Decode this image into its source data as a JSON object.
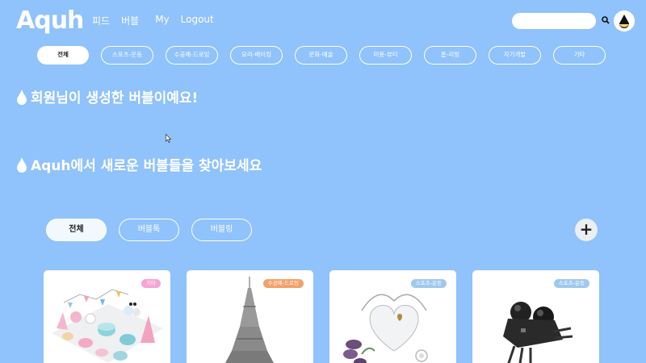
{
  "header": {
    "logo": "Aquh",
    "nav": [
      "피드",
      "버블",
      "My",
      "Logout"
    ],
    "search_placeholder": ""
  },
  "categories": [
    {
      "label": "전체",
      "active": true
    },
    {
      "label": "스포츠-운동",
      "active": false
    },
    {
      "label": "수공예-드로잉",
      "active": false
    },
    {
      "label": "요리-베이킹",
      "active": false
    },
    {
      "label": "문화-예술",
      "active": false
    },
    {
      "label": "미용-뷰티",
      "active": false
    },
    {
      "label": "홈-리빙",
      "active": false
    },
    {
      "label": "자기개발",
      "active": false
    },
    {
      "label": "기타",
      "active": false
    }
  ],
  "sections": {
    "my_bubbles": "회원님이 생성한 버블이예요!",
    "discover": "Aquh에서 새로운 버블들을 찾아보세요"
  },
  "tabs": [
    {
      "label": "전체",
      "active": true
    },
    {
      "label": "버블톡",
      "active": false
    },
    {
      "label": "버블링",
      "active": false
    }
  ],
  "add_label": "+",
  "cards": [
    {
      "badge": "기타",
      "badge_color": "#f7a3d6",
      "art": "cakes"
    },
    {
      "badge": "수공예-드로잉",
      "badge_color": "#f5a06a",
      "art": "tower"
    },
    {
      "badge": "스포츠-운동",
      "badge_color": "#9fc9ec",
      "art": "heart-bag"
    },
    {
      "badge": "스포츠-운동",
      "badge_color": "#9fc9ec",
      "art": "gadget"
    }
  ],
  "colors": {
    "background": "#90c2fb",
    "accent": "#ffffff"
  }
}
